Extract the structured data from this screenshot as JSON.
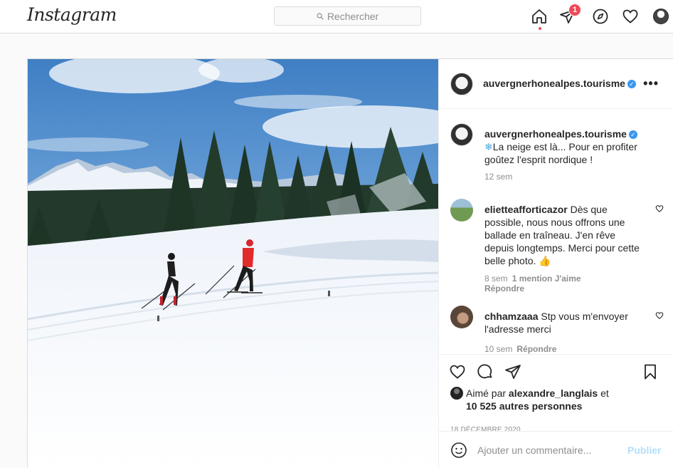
{
  "header": {
    "logo": "Instagram",
    "search_placeholder": "Rechercher",
    "notification_count": "1"
  },
  "post": {
    "author": "auvergnerhonealpes.tourisme",
    "more_label": "•••",
    "caption_emoji": "❄",
    "caption": "La neige est là... Pour en profiter goûtez l'esprit nordique !",
    "caption_time": "12 sem",
    "comments": [
      {
        "user": "elietteafforticazor",
        "text": "Dès que possible, nous nous offrons une ballade en traîneau. J'en rêve depuis longtemps. Merci pour cette belle photo.",
        "emoji": "👍",
        "time": "8 sem",
        "likes": "1 mention J'aime",
        "reply": "Répondre"
      },
      {
        "user": "chhamzaaa",
        "text": "Stp vous m'envoyer l'adresse merci",
        "time": "10 sem",
        "reply": "Répondre"
      }
    ],
    "liked_by_prefix": "Aimé par",
    "liked_by_user": "alexandre_langlais",
    "liked_by_and": "et",
    "liked_by_others": "10 525 autres personnes",
    "date": "18 DÉCEMBRE 2020",
    "comment_placeholder": "Ajouter un commentaire...",
    "publish_label": "Publier"
  },
  "colors": {
    "accent": "#3897f0",
    "badge": "#ed4956",
    "publish_disabled": "#b2dffc"
  },
  "icons": [
    "home-icon",
    "direct-icon",
    "explore-icon",
    "activity-heart-icon",
    "like-icon",
    "comment-icon",
    "share-icon",
    "bookmark-icon",
    "emoji-icon",
    "search-icon"
  ]
}
